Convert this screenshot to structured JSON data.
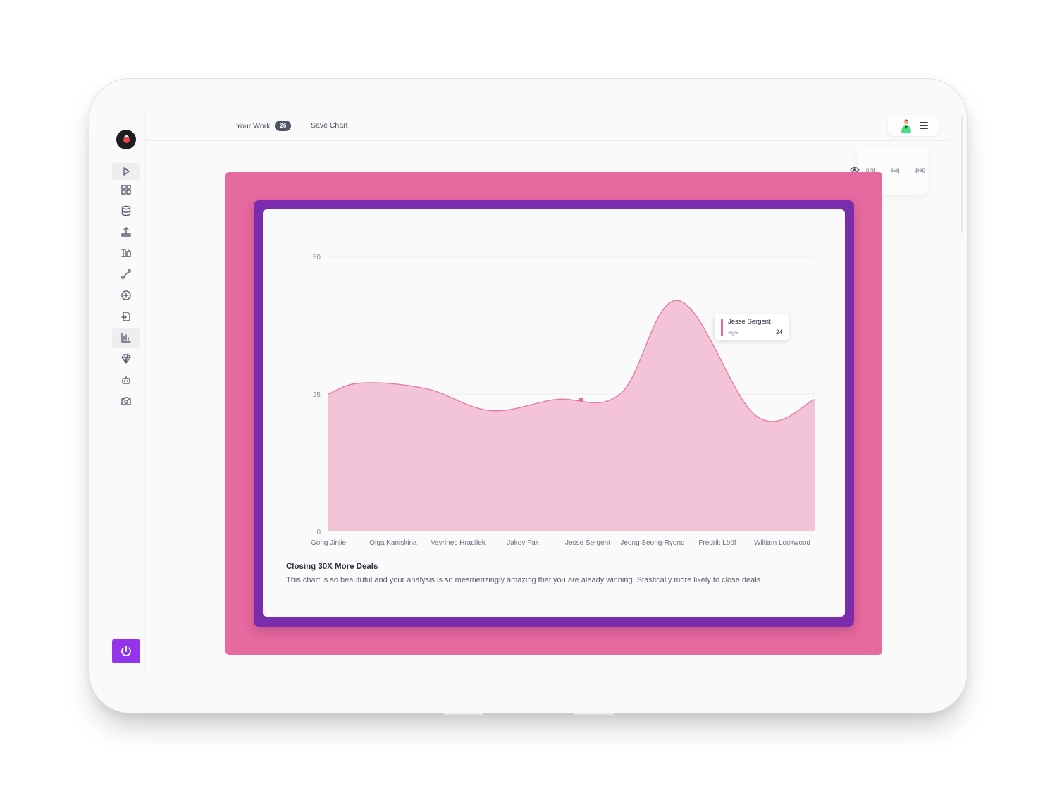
{
  "topbar": {
    "tabs": [
      {
        "label": "Your Work",
        "badge": "26"
      },
      {
        "label": "Save Chart"
      }
    ]
  },
  "sidebar": {
    "items": [
      {
        "icon": "play-icon",
        "active": true
      },
      {
        "icon": "dashboard-grid-icon"
      },
      {
        "icon": "database-icon"
      },
      {
        "icon": "upload-icon"
      },
      {
        "icon": "transform-icon"
      },
      {
        "icon": "pipeline-icon"
      },
      {
        "icon": "add-circle-icon"
      },
      {
        "icon": "import-file-icon"
      },
      {
        "icon": "bar-chart-icon",
        "active": true
      },
      {
        "icon": "diamond-icon"
      },
      {
        "icon": "robot-icon"
      },
      {
        "icon": "camera-icon"
      }
    ],
    "power_icon": "power-icon"
  },
  "export": {
    "options": [
      "png",
      "svg",
      "jpeg"
    ],
    "preview_icon": "eye-icon"
  },
  "colors": {
    "outer_frame": "#e6699f",
    "inner_frame": "#7b2cad",
    "area_fill": "#f3c3d8",
    "area_line": "#e87aa7",
    "power_button": "#9333ea"
  },
  "chart_data": {
    "type": "area",
    "categories": [
      "Gong Jinjie",
      "Olga Kaniskina",
      "Vavrinec Hradilek",
      "Jakov Fak",
      "Jesse Sergent",
      "Jeong Seong-Ryong",
      "Fredrik Lööf",
      "William Lockwood"
    ],
    "series": [
      {
        "values": [
          25,
          27,
          26,
          22,
          24,
          25,
          42,
          21,
          24
        ]
      }
    ],
    "x_points": [
      0,
      0.5,
      1.5,
      2.5,
      3.5,
      4.5,
      5.4,
      6.6,
      7.5
    ],
    "yticks": [
      0,
      25,
      50
    ],
    "ylim": [
      0,
      50
    ],
    "grid": true,
    "title": "Closing 30X More Deals",
    "description": "This chart is so beautuful and your analysis is so mesmerizingly amazing that you are aleady winning. Stastically more likely to close deals.",
    "tooltip": {
      "name": "Jesse Sergent",
      "key": "age",
      "value": "24"
    }
  }
}
